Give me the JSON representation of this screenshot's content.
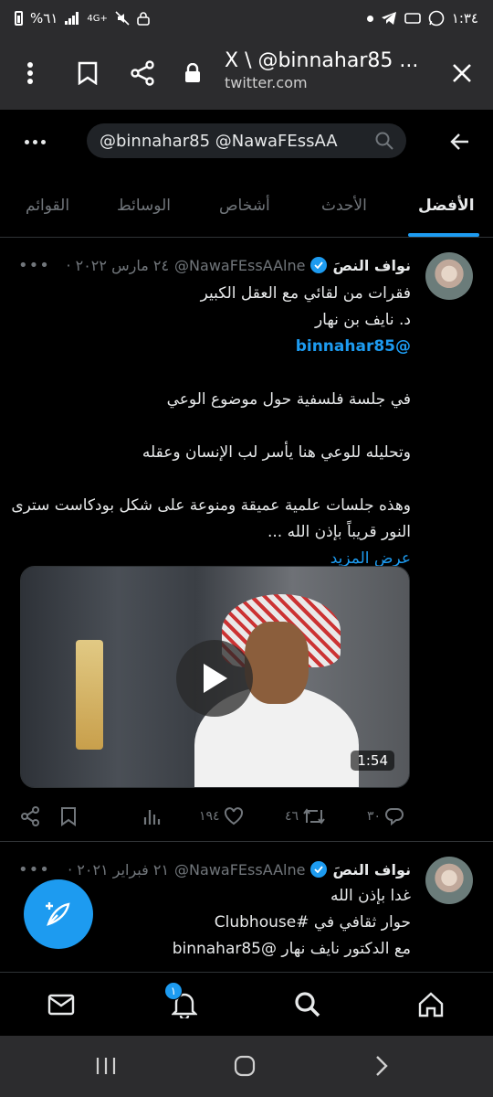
{
  "status_bar": {
    "time": "١:٣٤",
    "battery": "%٦١",
    "network": "4G+"
  },
  "browser": {
    "title": "X \\ @binnahar85 ...",
    "domain": "twitter.com"
  },
  "search": {
    "query": "@binnahar85 @NawaFEssAA"
  },
  "tabs": [
    {
      "label": "الأفضل",
      "active": true
    },
    {
      "label": "الأحدث"
    },
    {
      "label": "أشخاص"
    },
    {
      "label": "الوسائط"
    },
    {
      "label": "القوائم"
    }
  ],
  "tweets": [
    {
      "name": "نواف النصَ",
      "handle": "@NawaFEssAAlne",
      "date": "٢٤ مارس ٢٠٢٢",
      "lines": [
        "فقرات من لقائي مع العقل الكبير",
        "د. نايف بن نهار",
        "@binnahar85",
        "",
        "في جلسة فلسفية حول موضوع الوعي",
        "",
        "وتحليله للوعي هنا يأسر لب الإنسان وعقله",
        "",
        "وهذه جلسات علمية عميقة ومنوعة على شكل بودكاست سترى",
        "النور قريباً بإذن الله ..."
      ],
      "show_more": "عرض المزيد",
      "video_duration": "1:54",
      "replies": "٣٠",
      "retweets": "٤٦",
      "likes": "١٩٤"
    },
    {
      "name": "نواف النصَ",
      "handle": "@NawaFEssAAlne",
      "date": "٢١ فبراير ٢٠٢١",
      "lines": [
        "غدا بإذن الله",
        "حوار ثقافي في #Clubhouse",
        "مع الدكتور نايف نهار @binnahar85"
      ]
    }
  ],
  "bottom_nav": {
    "notifications_badge": "١"
  },
  "colors": {
    "accent": "#1d9bf0",
    "background": "#000000",
    "chrome": "#2c2c2e"
  }
}
